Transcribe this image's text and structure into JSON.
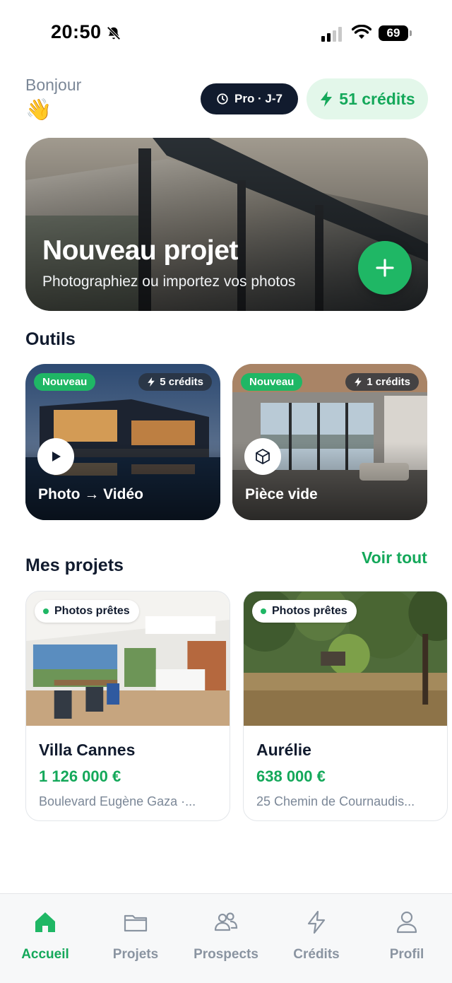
{
  "status_bar": {
    "time": "20:50",
    "battery": "69"
  },
  "header": {
    "greeting": "Bonjour",
    "wave_emoji": "👋",
    "plan_badge": "Pro · J-7",
    "credits_badge": "51 crédits"
  },
  "hero": {
    "title": "Nouveau projet",
    "subtitle": "Photographiez ou importez vos photos"
  },
  "tools": {
    "title": "Outils",
    "items": [
      {
        "badge": "Nouveau",
        "cost": "5 crédits",
        "label": "Photo → Vidéo",
        "icon": "play-icon"
      },
      {
        "badge": "Nouveau",
        "cost": "1 crédits",
        "label": "Pièce vide",
        "icon": "cube-icon"
      }
    ]
  },
  "projects": {
    "title": "Mes projets",
    "see_all": "Voir tout",
    "items": [
      {
        "status": "Photos prêtes",
        "name": "Villa Cannes",
        "price": "1 126 000 €",
        "address": "Boulevard Eugène Gaza ·..."
      },
      {
        "status": "Photos prêtes",
        "name": "Aurélie",
        "price": "638 000 €",
        "address": "25 Chemin de Cournaudis..."
      }
    ]
  },
  "tab_bar": {
    "active": "Accueil",
    "items": [
      {
        "label": "Accueil",
        "icon": "home-icon"
      },
      {
        "label": "Projets",
        "icon": "folder-icon"
      },
      {
        "label": "Prospects",
        "icon": "users-icon"
      },
      {
        "label": "Crédits",
        "icon": "bolt-icon"
      },
      {
        "label": "Profil",
        "icon": "user-icon"
      }
    ]
  },
  "colors": {
    "accent": "#1fb765",
    "accent_text": "#14a85a",
    "dark": "#111b2e",
    "muted": "#7b8797"
  }
}
